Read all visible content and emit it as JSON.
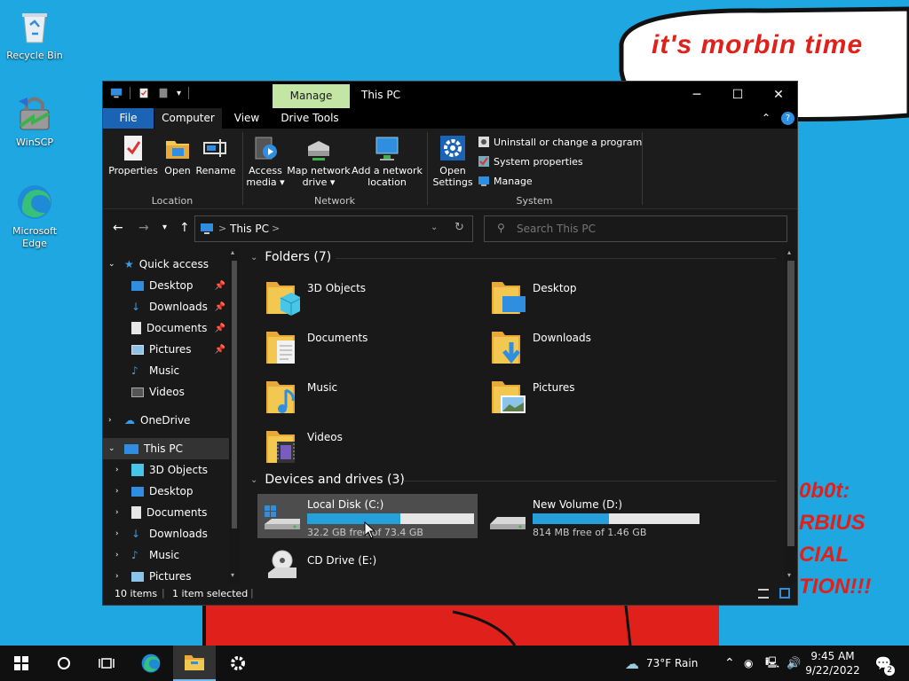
{
  "desktop": {
    "icons": [
      {
        "label": "Recycle Bin",
        "icon": "recycle-bin-icon"
      },
      {
        "label": "WinSCP",
        "icon": "winscp-icon"
      },
      {
        "label": "Microsoft Edge",
        "icon": "edge-icon"
      }
    ],
    "speech_text": "it's morbin time",
    "sign_lines": [
      "0b0t:",
      "RBIUS",
      "CIAL",
      "TION!!!"
    ]
  },
  "window": {
    "title": "This PC",
    "context_tab": "Manage",
    "tabs": [
      "File",
      "Computer",
      "View",
      "Drive Tools"
    ],
    "controls": {
      "minimize": "─",
      "maximize": "☐",
      "close": "✕"
    },
    "ribbon": {
      "location": {
        "label": "Location",
        "buttons": [
          "Properties",
          "Open",
          "Rename"
        ]
      },
      "network": {
        "label": "Network",
        "buttons": [
          {
            "line1": "Access",
            "line2": "media ▾"
          },
          {
            "line1": "Map network",
            "line2": "drive ▾"
          },
          {
            "line1": "Add a network",
            "line2": "location"
          }
        ]
      },
      "system": {
        "label": "System",
        "open_settings": {
          "line1": "Open",
          "line2": "Settings"
        },
        "items": [
          "Uninstall or change a program",
          "System properties",
          "Manage"
        ]
      }
    },
    "address": {
      "crumb": "This PC",
      "sep": ">"
    },
    "search_placeholder": "Search This PC",
    "nav": {
      "quick_access": "Quick access",
      "quick_items": [
        "Desktop",
        "Downloads",
        "Documents",
        "Pictures",
        "Music",
        "Videos"
      ],
      "onedrive": "OneDrive",
      "this_pc": "This PC",
      "pc_items": [
        "3D Objects",
        "Desktop",
        "Documents",
        "Downloads",
        "Music",
        "Pictures"
      ]
    },
    "folders": {
      "header": "Folders (7)",
      "items": [
        "3D Objects",
        "Desktop",
        "Documents",
        "Downloads",
        "Music",
        "Pictures",
        "Videos"
      ]
    },
    "devices": {
      "header": "Devices and drives (3)",
      "drives": [
        {
          "name": "Local Disk (C:)",
          "free_text": "32.2 GB free of 73.4 GB",
          "used_fraction": 0.56
        },
        {
          "name": "New Volume (D:)",
          "free_text": "814 MB free of 1.46 GB",
          "used_fraction": 0.46
        },
        {
          "name": "CD Drive (E:)"
        }
      ]
    },
    "status": {
      "count": "10 items",
      "selected": "1 item selected"
    }
  },
  "taskbar": {
    "weather": "73°F  Rain",
    "time": "9:45 AM",
    "date": "9/22/2022",
    "notifications": "2"
  },
  "colors": {
    "accent": "#1b63b4",
    "manage_tab": "#c3e6a5",
    "progress": "#26a0da",
    "folder": "#f3c851"
  }
}
